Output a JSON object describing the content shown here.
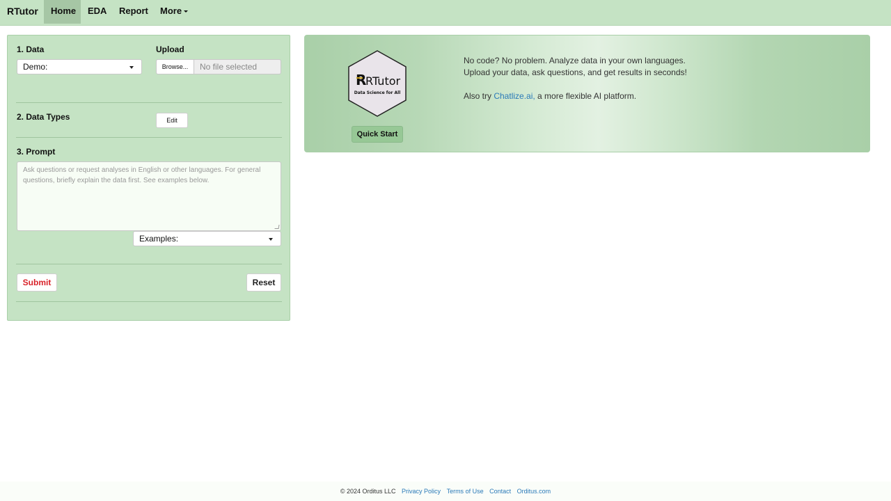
{
  "navbar": {
    "brand": "RTutor",
    "items": [
      {
        "label": "Home"
      },
      {
        "label": "EDA"
      },
      {
        "label": "Report"
      },
      {
        "label": "More"
      }
    ]
  },
  "left_panel": {
    "data_label": "1. Data",
    "data_select_value": "Demo:",
    "upload_label": "Upload",
    "browse_label": "Browse...",
    "file_placeholder": "No file selected",
    "data_types_label": "2. Data Types",
    "edit_label": "Edit",
    "prompt_label": "3. Prompt",
    "prompt_placeholder": "Ask questions or request analyses in English or other languages. For general questions, briefly explain the data first. See examples below.",
    "examples_value": "Examples:",
    "submit_label": "Submit",
    "reset_label": "Reset"
  },
  "banner": {
    "logo_text": "RTutor",
    "logo_subtitle": "Data Science for All",
    "quick_start_label": "Quick Start",
    "line1": "No code? No problem. Analyze data in your own languages.",
    "line2": "Upload your data, ask questions, and get results in seconds!",
    "also_try_prefix": "Also try ",
    "also_try_link": "Chatlize.ai,",
    "also_try_suffix": " a more flexible AI platform."
  },
  "footer": {
    "copyright": "© 2024 Orditus LLC",
    "links": [
      "Privacy Policy",
      "Terms of Use",
      "Contact",
      "Orditus.com"
    ]
  },
  "colors": {
    "accent_green": "#c5e3c4",
    "link_blue": "#2a7ab8",
    "submit_red": "#d9232a"
  }
}
